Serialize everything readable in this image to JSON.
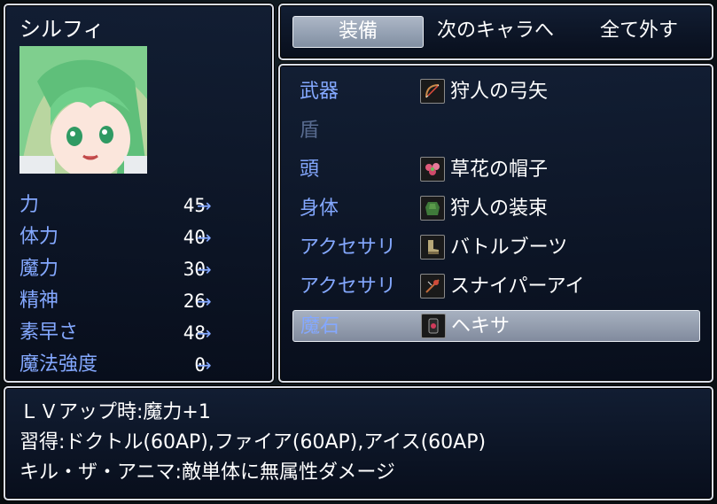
{
  "actor": {
    "name": "シルフィ"
  },
  "params": [
    {
      "label": "力",
      "value": "45",
      "arrow": "→"
    },
    {
      "label": "体力",
      "value": "40",
      "arrow": "→"
    },
    {
      "label": "魔力",
      "value": "30",
      "arrow": "→"
    },
    {
      "label": "精神",
      "value": "26",
      "arrow": "→"
    },
    {
      "label": "素早さ",
      "value": "48",
      "arrow": "→"
    },
    {
      "label": "魔法強度",
      "value": "0",
      "arrow": "→"
    }
  ],
  "commands": {
    "equip": "装備",
    "next_actor": "次のキャラへ",
    "clear_all": "全て外す",
    "selected": "equip"
  },
  "slots": [
    {
      "label": "武器",
      "item": "狩人の弓矢",
      "icon": "bow-arrow-icon",
      "enabled": true
    },
    {
      "label": "盾",
      "item": "",
      "icon": "",
      "enabled": false
    },
    {
      "label": "頭",
      "item": "草花の帽子",
      "icon": "flower-hat-icon",
      "enabled": true
    },
    {
      "label": "身体",
      "item": "狩人の装束",
      "icon": "hunter-garb-icon",
      "enabled": true
    },
    {
      "label": "アクセサリ",
      "item": "バトルブーツ",
      "icon": "boots-icon",
      "enabled": true
    },
    {
      "label": "アクセサリ",
      "item": "スナイパーアイ",
      "icon": "sniper-eye-icon",
      "enabled": true
    },
    {
      "label": "魔石",
      "item": "ヘキサ",
      "icon": "magic-stone-icon",
      "enabled": true,
      "selected": true
    }
  ],
  "help": {
    "line1": "ＬＶアップ時:魔力+1",
    "line2": "習得:ドクトル(60AP),ファイア(60AP),アイス(60AP)",
    "line3": "キル・ザ・アニマ:敵単体に無属性ダメージ"
  },
  "colors": {
    "system_blue": "#84a8ff",
    "window_border": "#d9dde6",
    "window_bg": "#0c1628"
  }
}
